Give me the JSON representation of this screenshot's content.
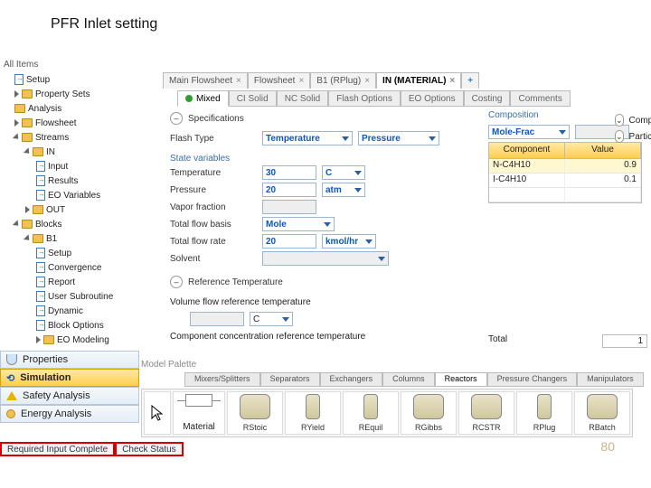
{
  "slide": {
    "title": "PFR Inlet setting",
    "page_number": "80"
  },
  "header": {
    "all_items": "All Items"
  },
  "nav": {
    "items": [
      {
        "label": "Setup",
        "icon": "sheet",
        "indent": 1
      },
      {
        "label": "Property Sets",
        "icon": "folder",
        "indent": 1,
        "tri": "closed"
      },
      {
        "label": "Analysis",
        "icon": "folder",
        "indent": 1
      },
      {
        "label": "Flowsheet",
        "icon": "folder",
        "indent": 1,
        "tri": "closed"
      },
      {
        "label": "Streams",
        "icon": "folder",
        "indent": 1,
        "tri": "open"
      },
      {
        "label": "IN",
        "icon": "folder",
        "indent": 2,
        "tri": "open"
      },
      {
        "label": "Input",
        "icon": "sheet",
        "indent": 3
      },
      {
        "label": "Results",
        "icon": "sheet",
        "indent": 3
      },
      {
        "label": "EO Variables",
        "icon": "sheet",
        "indent": 3
      },
      {
        "label": "OUT",
        "icon": "folder",
        "indent": 2,
        "tri": "closed"
      },
      {
        "label": "Blocks",
        "icon": "folder",
        "indent": 1,
        "tri": "open"
      },
      {
        "label": "B1",
        "icon": "folder",
        "indent": 2,
        "tri": "open"
      },
      {
        "label": "Setup",
        "icon": "sheet",
        "indent": 3
      },
      {
        "label": "Convergence",
        "icon": "sheet",
        "indent": 3
      },
      {
        "label": "Report",
        "icon": "sheet",
        "indent": 3
      },
      {
        "label": "User Subroutine",
        "icon": "sheet",
        "indent": 3
      },
      {
        "label": "Dynamic",
        "icon": "sheet",
        "indent": 3
      },
      {
        "label": "Block Options",
        "icon": "sheet",
        "indent": 3
      },
      {
        "label": "EO Modeling",
        "icon": "folder",
        "indent": 3,
        "tri": "closed"
      }
    ]
  },
  "left_panels": {
    "properties": "Properties",
    "simulation": "Simulation",
    "safety": "Safety Analysis",
    "energy": "Energy Analysis"
  },
  "tabs": {
    "items": [
      {
        "label": "Main Flowsheet"
      },
      {
        "label": "Flowsheet"
      },
      {
        "label": "B1 (RPlug)"
      },
      {
        "label": "IN (MATERIAL)",
        "active": true
      }
    ]
  },
  "subtabs": {
    "items": [
      {
        "label": "Mixed",
        "active": true,
        "dot": true
      },
      {
        "label": "CI Solid"
      },
      {
        "label": "NC Solid"
      },
      {
        "label": "Flash Options"
      },
      {
        "label": "EO Options"
      },
      {
        "label": "Costing"
      },
      {
        "label": "Comments"
      }
    ]
  },
  "form": {
    "spec_header": "Specifications",
    "flash_type_label": "Flash Type",
    "flash_type_1": "Temperature",
    "flash_type_2": "Pressure",
    "state_vars": "State variables",
    "temperature_label": "Temperature",
    "temperature_value": "30",
    "temperature_unit": "C",
    "pressure_label": "Pressure",
    "pressure_value": "20",
    "pressure_unit": "atm",
    "vapor_fraction_label": "Vapor fraction",
    "total_flow_basis_label": "Total flow basis",
    "total_flow_basis": "Mole",
    "total_flow_rate_label": "Total flow rate",
    "total_flow_rate_value": "20",
    "total_flow_rate_unit": "kmol/hr",
    "solvent_label": "Solvent",
    "ref_temp_header": "Reference Temperature",
    "vol_ref_label": "Volume flow reference temperature",
    "vol_ref_unit": "C",
    "conc_ref_label": "Component concentration reference temperature"
  },
  "right": {
    "comp_header": "Composition",
    "basis": "Mole-Frac",
    "col_component": "Component",
    "col_value": "Value",
    "rows": [
      {
        "component": "N-C4H10",
        "value": "0.9"
      },
      {
        "component": "I-C4H10",
        "value": "0.1"
      }
    ],
    "total_label": "Total",
    "total_value": "1",
    "side_comp": "Comp",
    "side_partic": "Partic"
  },
  "palette": {
    "label": "Model Palette",
    "tabs": [
      "Mixers/Splitters",
      "Separators",
      "Exchangers",
      "Columns",
      "Reactors",
      "Pressure Changers",
      "Manipulators"
    ],
    "active_tab": "Reactors",
    "material": "Material",
    "icons": [
      "RStoic",
      "RYield",
      "REquil",
      "RGibbs",
      "RCSTR",
      "RPlug",
      "RBatch"
    ]
  },
  "status": {
    "required": "Required Input Complete",
    "check": "Check Status"
  }
}
